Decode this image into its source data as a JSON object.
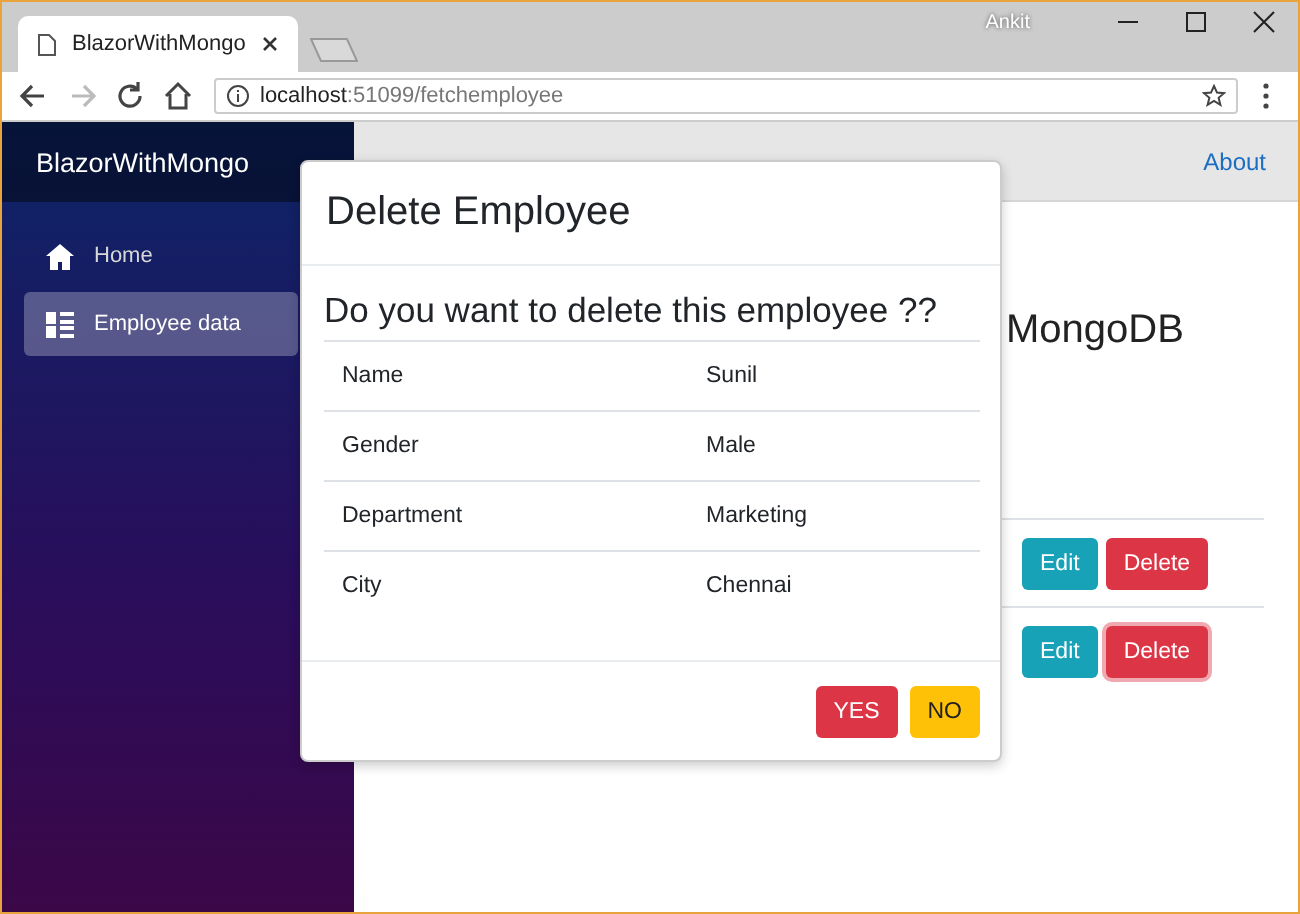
{
  "browser": {
    "user": "Ankit",
    "tab_title": "BlazorWithMongo",
    "url_host": "localhost",
    "url_path": ":51099/fetchemployee"
  },
  "sidebar": {
    "brand": "BlazorWithMongo",
    "items": [
      {
        "label": "Home",
        "kind": "home",
        "selected": false
      },
      {
        "label": "Employee data",
        "kind": "list",
        "selected": true
      }
    ]
  },
  "top_bar": {
    "link": "About"
  },
  "main": {
    "heading": "MongoDB",
    "rows": [
      {
        "edit": "Edit",
        "delete": "Delete",
        "focused": false
      },
      {
        "edit": "Edit",
        "delete": "Delete",
        "focused": true
      }
    ]
  },
  "modal": {
    "title": "Delete Employee",
    "question": "Do you want to delete this employee ??",
    "details": [
      {
        "label": "Name",
        "value": "Sunil"
      },
      {
        "label": "Gender",
        "value": "Male"
      },
      {
        "label": "Department",
        "value": "Marketing"
      },
      {
        "label": "City",
        "value": "Chennai"
      }
    ],
    "buttons": [
      {
        "label": "YES",
        "kind": "danger"
      },
      {
        "label": "NO",
        "kind": "warning"
      }
    ]
  }
}
